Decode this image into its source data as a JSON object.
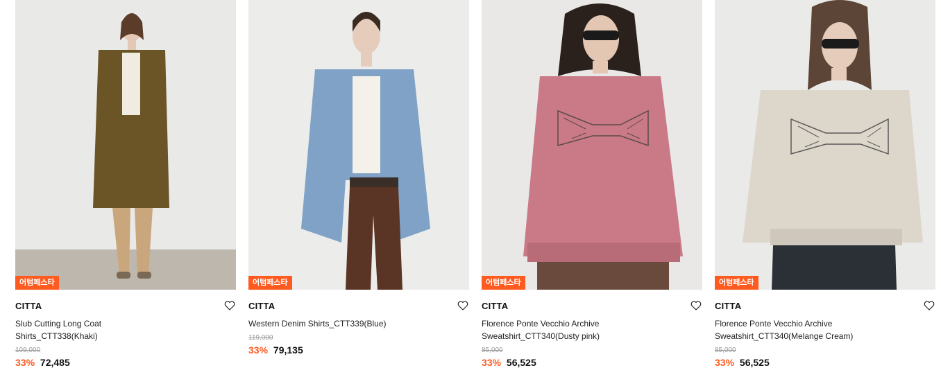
{
  "products": [
    {
      "badge": "어텀페스타",
      "brand": "CITTA",
      "name": "Slub Cutting Long Coat Shirts_CTT338(Khaki)",
      "original_price": "109,000",
      "discount": "33%",
      "price": "72,485",
      "image_desc": "khaki-long-coat-shirt"
    },
    {
      "badge": "어텀페스타",
      "brand": "CITTA",
      "name": "Western Denim Shirts_CTT339(Blue)",
      "original_price": "119,000",
      "discount": "33%",
      "price": "79,135",
      "image_desc": "blue-denim-shirt"
    },
    {
      "badge": "어텀페스타",
      "brand": "CITTA",
      "name": "Florence Ponte Vecchio Archive Sweatshirt_CTT340(Dusty pink)",
      "original_price": "85,000",
      "discount": "33%",
      "price": "56,525",
      "image_desc": "dusty-pink-sweatshirt"
    },
    {
      "badge": "어텀페스타",
      "brand": "CITTA",
      "name": "Florence Ponte Vecchio Archive Sweatshirt_CTT340(Melange Cream)",
      "original_price": "85,000",
      "discount": "33%",
      "price": "56,525",
      "image_desc": "melange-cream-sweatshirt"
    }
  ],
  "colors": {
    "badge_bg": "#ff5a1f",
    "discount": "#ff5a1f",
    "photo_bg": "#ebebea",
    "khaki": "#6b5426",
    "denim": "#7fa2c6",
    "pink": "#c97a86",
    "cream": "#ddd6cb"
  }
}
